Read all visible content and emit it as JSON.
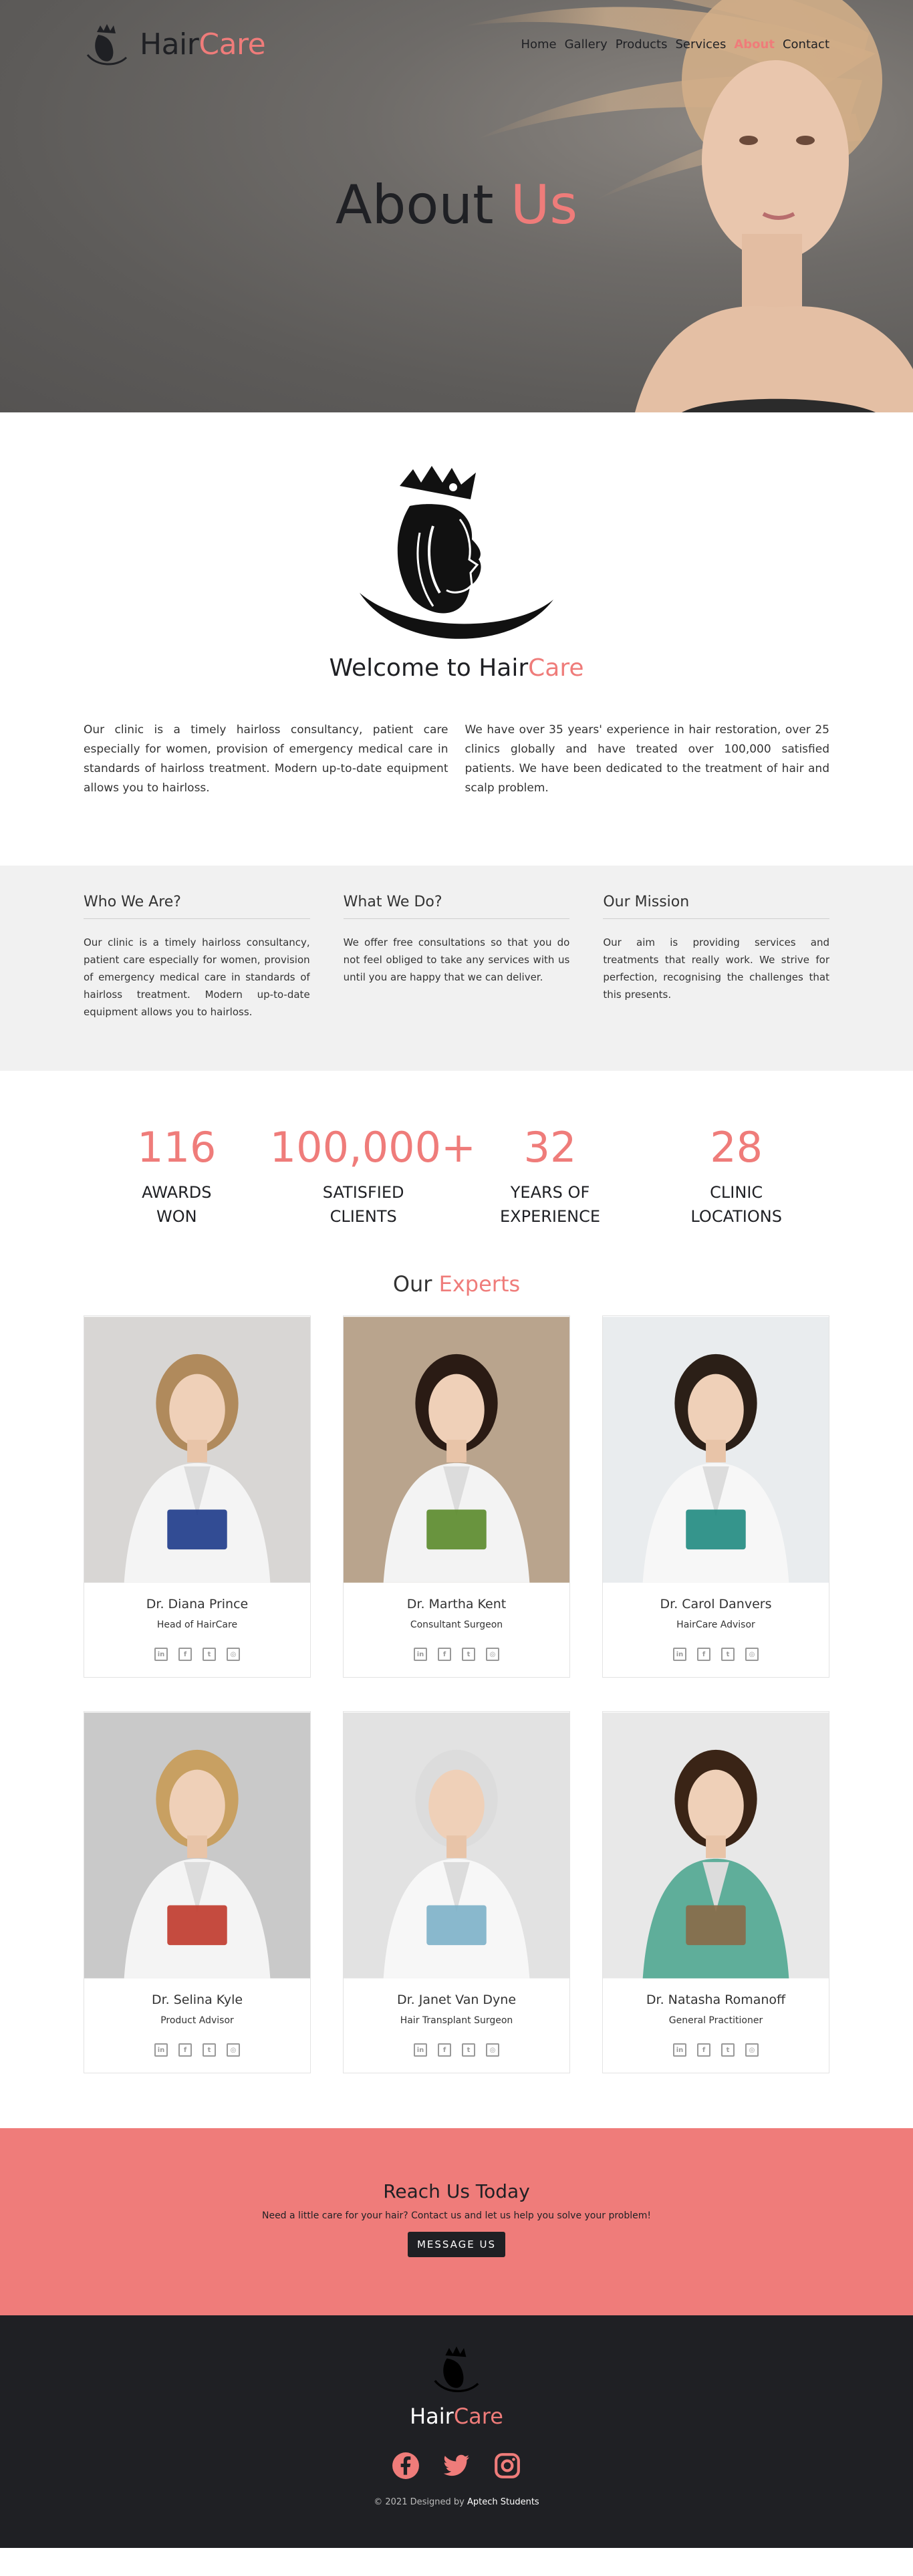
{
  "brand": {
    "name_part1": "Hair",
    "name_part2": "Care"
  },
  "nav": {
    "items": [
      {
        "label": "Home",
        "active": false
      },
      {
        "label": "Gallery",
        "active": false
      },
      {
        "label": "Products",
        "active": false
      },
      {
        "label": "Services",
        "active": false
      },
      {
        "label": "About",
        "active": true
      },
      {
        "label": "Contact",
        "active": false
      }
    ]
  },
  "hero": {
    "title_part1": "About ",
    "title_part2": "Us"
  },
  "welcome": {
    "heading_part1": "Welcome to Hair",
    "heading_part2": "Care",
    "left_text": "Our clinic is a timely hairloss consultancy, patient care especially for women, provision of emergency medical care in standards of hairloss treatment. Modern up-to-date equipment allows you to hairloss.",
    "right_text": "We have over 35 years' experience in hair restoration, over 25 clinics globally and have treated over 100,000 satisfied patients. We have been dedicated to the treatment of hair and scalp problem."
  },
  "info": {
    "who_title": "Who We Are?",
    "who_text": "Our clinic is a timely hairloss consultancy, patient care especially for women, provision of emergency medical care in standards of hairloss treatment. Modern up-to-date equipment allows you to hairloss.",
    "what_title": "What We Do?",
    "what_text": "We offer free consultations so that you do not feel obliged to take any services with us until you are happy that we can deliver.",
    "mission_title": "Our Mission",
    "mission_text": "Our aim is providing services and treatments that really work. We strive for perfection, recognising the challenges that this presents."
  },
  "stats": [
    {
      "num": "116",
      "label": "AWARDS WON"
    },
    {
      "num": "100,000+",
      "label": "SATISFIED CLIENTS"
    },
    {
      "num": "32",
      "label": "YEARS OF EXPERIENCE"
    },
    {
      "num": "28",
      "label": "CLINIC LOCATIONS"
    }
  ],
  "experts": {
    "heading_part1": "Our ",
    "heading_part2": "Experts",
    "people": [
      {
        "name": "Dr. Diana Prince",
        "role": "Head of HairCare",
        "bg": "#d8d6d4",
        "hair": "#b08a5c",
        "coat": "#f4f4f4",
        "prop": "#1d3a8a"
      },
      {
        "name": "Dr. Martha Kent",
        "role": "Consultant Surgeon",
        "bg": "#b9a48d",
        "hair": "#2a1b14",
        "coat": "#f3f3f3",
        "prop": "#5a8a2a"
      },
      {
        "name": "Dr. Carol Danvers",
        "role": "HairCare Advisor",
        "bg": "#e9ecee",
        "hair": "#2b1f17",
        "coat": "#f7f7f7",
        "prop": "#1f8a80"
      },
      {
        "name": "Dr. Selina Kyle",
        "role": "Product Advisor",
        "bg": "#c9c9c9",
        "hair": "#c8a062",
        "coat": "#f4f4f4",
        "prop": "#c0392b"
      },
      {
        "name": "Dr. Janet Van Dyne",
        "role": "Hair Transplant Surgeon",
        "bg": "#e2e2e2",
        "hair": "#dcdcdc",
        "coat": "#f7f7f7",
        "prop": "#7cb0c8"
      },
      {
        "name": "Dr. Natasha Romanoff",
        "role": "General Practitioner",
        "bg": "#e8e8e8",
        "hair": "#3a2416",
        "coat": "#5fae9a",
        "prop": "#8a6a48"
      }
    ],
    "social_icons": [
      "linkedin-icon",
      "facebook-icon",
      "twitter-icon",
      "instagram-icon"
    ]
  },
  "cta": {
    "title": "Reach Us Today",
    "subtitle": "Need a little care for your hair? Contact us and let us help you solve your problem!",
    "button": "MESSAGE US"
  },
  "footer": {
    "name_part1": "Hair",
    "name_part2": "Care",
    "icons": [
      "facebook-icon",
      "twitter-icon",
      "instagram-icon"
    ],
    "copyright": "© 2021 Designed by",
    "designer": "Aptech Students"
  },
  "colors": {
    "accent": "#ef7c7a",
    "dark": "#1f2024",
    "grey_section": "#f1f1f1"
  }
}
